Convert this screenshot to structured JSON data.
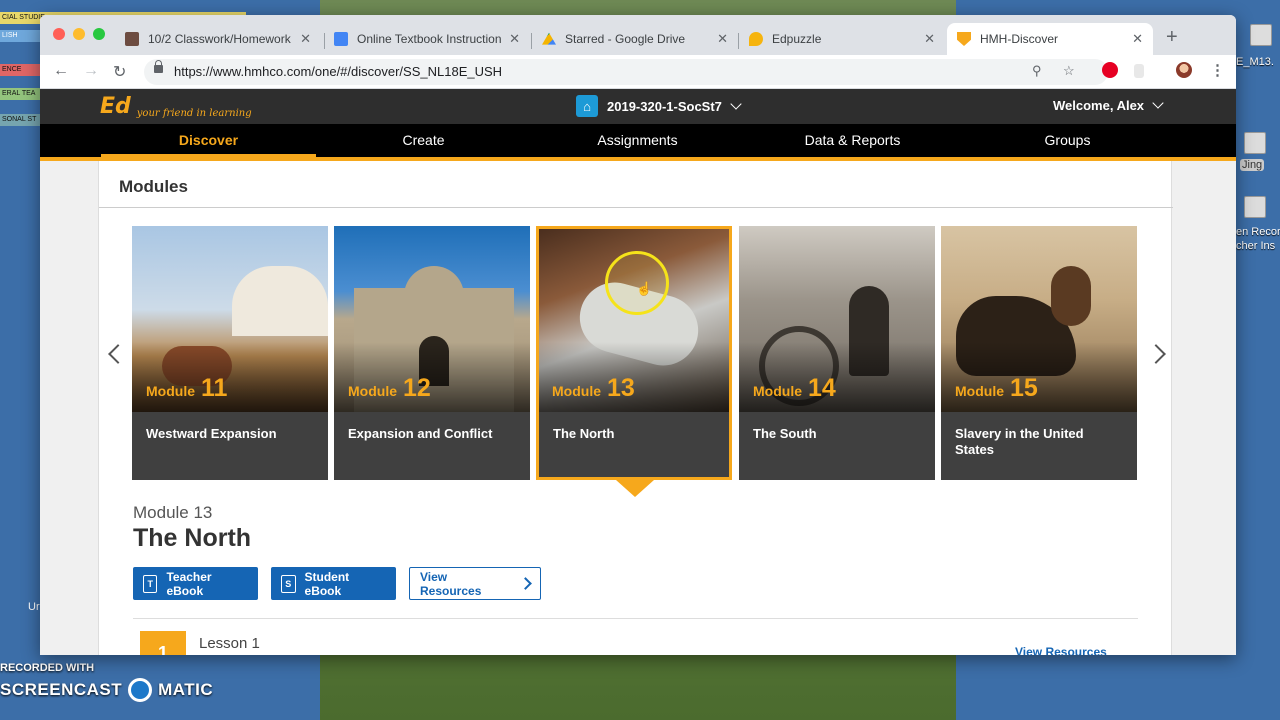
{
  "desktop": {
    "left_labels": [
      "CIAL STUDIE",
      "LISH",
      "ENCE",
      "ERAL TEA",
      "SONAL ST"
    ],
    "right_files": [
      "E_M13.",
      "Jing",
      "en Recor",
      "cher Ins"
    ],
    "left_partial": "Ur",
    "watermark_line1": "RECORDED WITH",
    "watermark_left": "SCREENCAST",
    "watermark_right": "MATIC"
  },
  "browser": {
    "tabs": [
      {
        "title": "10/2 Classwork/Homework",
        "favicon": "classroom-icon",
        "color": "#6d4c41"
      },
      {
        "title": "Online Textbook Instruction",
        "favicon": "docs-icon",
        "color": "#4285f4"
      },
      {
        "title": "Starred - Google Drive",
        "favicon": "drive-icon",
        "color": "#0f9d58"
      },
      {
        "title": "Edpuzzle",
        "favicon": "edpuzzle-icon",
        "color": "#f6b40e"
      },
      {
        "title": "HMH-Discover",
        "favicon": "hmh-icon",
        "color": "#f6a81c"
      }
    ],
    "url": "https://www.hmhco.com/one/#/discover/SS_NL18E_USH"
  },
  "app": {
    "logo_text": "Ed",
    "logo_tagline": "your friend in learning",
    "class_name": "2019-320-1-SocSt7",
    "welcome": "Welcome, Alex",
    "nav": [
      "Discover",
      "Create",
      "Assignments",
      "Data & Reports",
      "Groups"
    ],
    "active_nav": "Discover",
    "accent": "#f6a81c"
  },
  "modules": {
    "heading": "Modules",
    "word": "Module",
    "cards": [
      {
        "num": "11",
        "name": "Westward Expansion"
      },
      {
        "num": "12",
        "name": "Expansion and Conflict"
      },
      {
        "num": "13",
        "name": "The North"
      },
      {
        "num": "14",
        "name": "The South"
      },
      {
        "num": "15",
        "name": "Slavery in the United States"
      }
    ],
    "selected_index": 2
  },
  "detail": {
    "module_label": "Module 13",
    "title": "The North",
    "teacher_ebook": "Teacher eBook",
    "student_ebook": "Student eBook",
    "view_resources": "View Resources",
    "lesson_num": "1",
    "lesson_label": "Lesson 1",
    "lesson_resources": "View Resources"
  }
}
